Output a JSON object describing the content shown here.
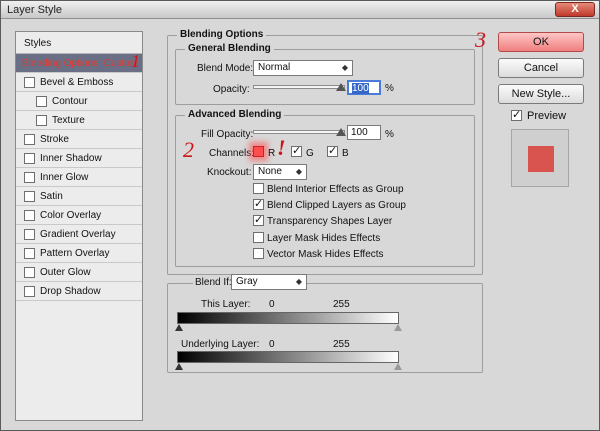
{
  "window": {
    "title": "Layer Style",
    "close_label": "X"
  },
  "styles_panel": {
    "header": "Styles",
    "items": [
      {
        "label": "Blending Options: Custom",
        "selected": true,
        "annotation": "1"
      },
      {
        "label": "Bevel & Emboss"
      },
      {
        "label": "Contour",
        "sub": true
      },
      {
        "label": "Texture",
        "sub": true
      },
      {
        "label": "Stroke"
      },
      {
        "label": "Inner Shadow"
      },
      {
        "label": "Inner Glow"
      },
      {
        "label": "Satin"
      },
      {
        "label": "Color Overlay"
      },
      {
        "label": "Gradient Overlay"
      },
      {
        "label": "Pattern Overlay"
      },
      {
        "label": "Outer Glow"
      },
      {
        "label": "Drop Shadow"
      }
    ]
  },
  "blending_options": {
    "title": "Blending Options",
    "general": {
      "title": "General Blending",
      "blend_mode_label": "Blend Mode:",
      "blend_mode_value": "Normal",
      "opacity_label": "Opacity:",
      "opacity_value": "100",
      "percent": "%"
    },
    "advanced": {
      "title": "Advanced Blending",
      "fill_opacity_label": "Fill Opacity:",
      "fill_opacity_value": "100",
      "percent": "%",
      "channels_label": "Channels:",
      "channel_r": "R",
      "channel_g": "G",
      "channel_b": "B",
      "knockout_label": "Knockout:",
      "knockout_value": "None",
      "options": [
        {
          "label": "Blend Interior Effects as Group",
          "checked": false
        },
        {
          "label": "Blend Clipped Layers as Group",
          "checked": true
        },
        {
          "label": "Transparency Shapes Layer",
          "checked": true
        },
        {
          "label": "Layer Mask Hides Effects",
          "checked": false
        },
        {
          "label": "Vector Mask Hides Effects",
          "checked": false
        }
      ]
    },
    "blend_if": {
      "label": "Blend If:",
      "value": "Gray",
      "this_layer_label": "This Layer:",
      "this_layer_min": "0",
      "this_layer_max": "255",
      "underlying_label": "Underlying Layer:",
      "underlying_min": "0",
      "underlying_max": "255"
    }
  },
  "annotations": {
    "two": "2",
    "three": "3",
    "exclaim": "!"
  },
  "buttons": {
    "ok": "OK",
    "cancel": "Cancel",
    "new_style": "New Style...",
    "preview": "Preview"
  },
  "colors": {
    "accent_red": "#d0151a",
    "preview_swatch": "#d9534f"
  }
}
